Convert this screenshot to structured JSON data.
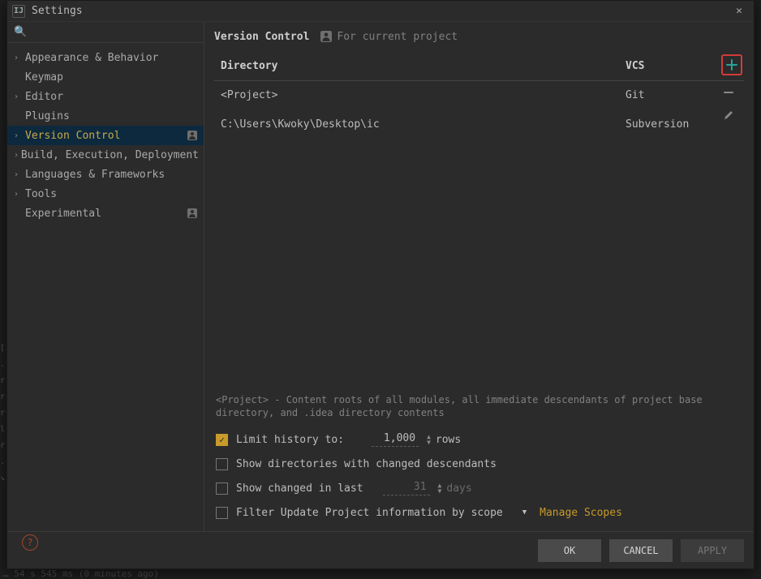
{
  "window": {
    "title": "Settings"
  },
  "search": {
    "placeholder": ""
  },
  "sidebar": {
    "items": [
      {
        "label": "Appearance & Behavior",
        "expandable": true,
        "badge": false
      },
      {
        "label": "Keymap",
        "expandable": false,
        "badge": false
      },
      {
        "label": "Editor",
        "expandable": true,
        "badge": false
      },
      {
        "label": "Plugins",
        "expandable": false,
        "badge": false
      },
      {
        "label": "Version Control",
        "expandable": true,
        "badge": true,
        "selected": true
      },
      {
        "label": "Build, Execution, Deployment",
        "expandable": true,
        "badge": false
      },
      {
        "label": "Languages & Frameworks",
        "expandable": true,
        "badge": false
      },
      {
        "label": "Tools",
        "expandable": true,
        "badge": false
      },
      {
        "label": "Experimental",
        "expandable": false,
        "badge": true
      }
    ]
  },
  "page": {
    "title": "Version Control",
    "subtitle": "For current project",
    "columns": {
      "dir": "Directory",
      "vcs": "VCS"
    },
    "rows": [
      {
        "dir": "<Project>",
        "vcs": "Git"
      },
      {
        "dir": "C:\\Users\\Kwoky\\Desktop\\ic",
        "vcs": "Subversion"
      }
    ],
    "description": "<Project> - Content roots of all modules, all immediate descendants of project base directory, and .idea directory contents",
    "opt_limit": {
      "label": "Limit history to:",
      "value": "1,000",
      "unit": "rows",
      "checked": true
    },
    "opt_dirs": {
      "label": "Show directories with changed descendants",
      "checked": false
    },
    "opt_changed": {
      "label": "Show changed in last",
      "value": "31",
      "unit": "days",
      "checked": false
    },
    "opt_scope": {
      "label": "Filter Update Project information by scope",
      "checked": false,
      "link": "Manage Scopes"
    }
  },
  "buttons": {
    "ok": "OK",
    "cancel": "CANCEL",
    "apply": "APPLY"
  },
  "status_hint": "… 54 s 545 ms (0 minutes ago)"
}
